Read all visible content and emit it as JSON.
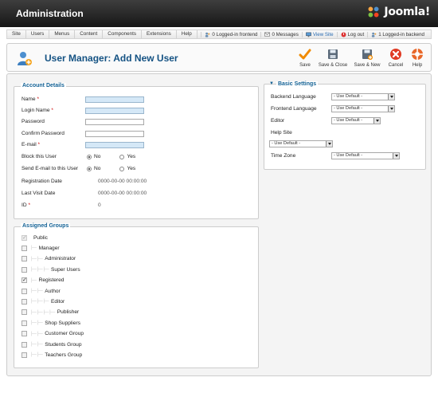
{
  "header": {
    "title": "Administration",
    "logo_text": "Joomla!"
  },
  "menu": {
    "items": [
      "Site",
      "Users",
      "Menus",
      "Content",
      "Components",
      "Extensions",
      "Help"
    ],
    "status": {
      "frontend": "0 Logged-in frontend",
      "messages": "0 Messages",
      "view_site": "View Site",
      "logout": "Log out",
      "backend": "1 Logged-in backend"
    }
  },
  "toolbar": {
    "page_title": "User Manager: Add New User",
    "save": "Save",
    "save_close": "Save & Close",
    "save_new": "Save & New",
    "cancel": "Cancel",
    "help": "Help"
  },
  "account": {
    "legend": "Account Details",
    "name": "Name",
    "login": "Login Name",
    "password": "Password",
    "confirm": "Confirm Password",
    "email": "E-mail",
    "block": "Block this User",
    "send_email": "Send E-mail to this User",
    "no": "No",
    "yes": "Yes",
    "reg_date_label": "Registration Date",
    "reg_date_value": "0000-00-00 00:00:00",
    "last_visit_label": "Last Visit Date",
    "last_visit_value": "0000-00-00 00:00:00",
    "id_label": "ID",
    "id_value": "0",
    "required_mark": "*"
  },
  "groups": {
    "legend": "Assigned Groups",
    "items": [
      {
        "label": "Public",
        "checked": true,
        "disabled": true,
        "tree": ""
      },
      {
        "label": "Manager",
        "checked": false,
        "tree": "|—"
      },
      {
        "label": "Administrator",
        "checked": false,
        "tree": "|— |—"
      },
      {
        "label": "Super Users",
        "checked": false,
        "tree": "|— |— |—"
      },
      {
        "label": "Registered",
        "checked": true,
        "tree": "|—"
      },
      {
        "label": "Author",
        "checked": false,
        "tree": "|— |—"
      },
      {
        "label": "Editor",
        "checked": false,
        "tree": "|— |— |—"
      },
      {
        "label": "Publisher",
        "checked": false,
        "tree": "|— |— |— |—"
      },
      {
        "label": "Shop Suppliers",
        "checked": false,
        "tree": "|— |—"
      },
      {
        "label": "Customer Group",
        "checked": false,
        "tree": "|— |—"
      },
      {
        "label": "Students Group",
        "checked": false,
        "tree": "|— |—"
      },
      {
        "label": "Teachers Group",
        "checked": false,
        "tree": "|— |—"
      }
    ]
  },
  "basic": {
    "legend": "Basic Settings",
    "backend_language": "Backend Language",
    "frontend_language": "Frontend Language",
    "editor": "Editor",
    "help_site": "Help Site",
    "time_zone": "Time Zone",
    "default_option": "- Use Default -"
  }
}
